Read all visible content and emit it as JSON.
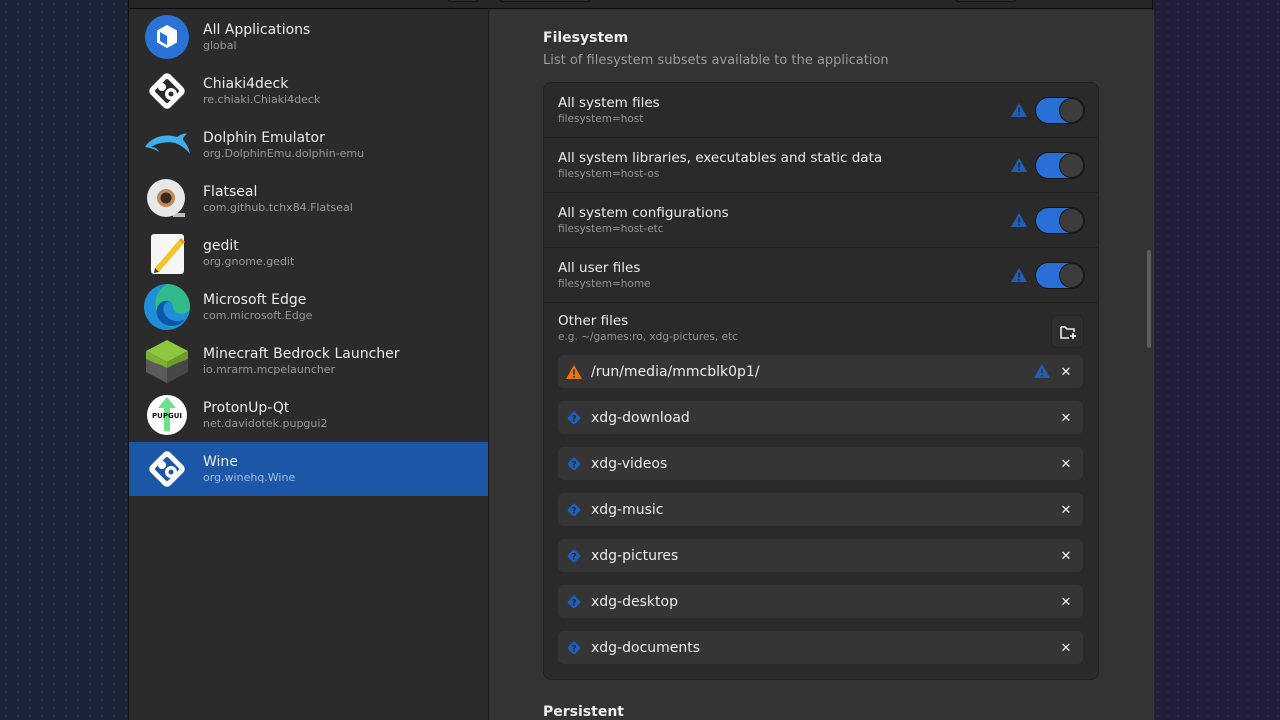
{
  "sidebar": {
    "apps": [
      {
        "name": "All Applications",
        "id": "global",
        "icon": "flatpak-box-icon",
        "selected": false
      },
      {
        "name": "Chiaki4deck",
        "id": "re.chiaki.Chiaki4deck",
        "icon": "chiaki-icon",
        "selected": false
      },
      {
        "name": "Dolphin Emulator",
        "id": "org.DolphinEmu.dolphin-emu",
        "icon": "dolphin-icon",
        "selected": false
      },
      {
        "name": "Flatseal",
        "id": "com.github.tchx84.Flatseal",
        "icon": "tape-roll-icon",
        "selected": false
      },
      {
        "name": "gedit",
        "id": "org.gnome.gedit",
        "icon": "notepad-pencil-icon",
        "selected": false
      },
      {
        "name": "Microsoft Edge",
        "id": "com.microsoft.Edge",
        "icon": "edge-icon",
        "selected": false
      },
      {
        "name": "Minecraft Bedrock Launcher",
        "id": "io.mrarm.mcpelauncher",
        "icon": "grass-block-icon",
        "selected": false
      },
      {
        "name": "ProtonUp-Qt",
        "id": "net.davidotek.pupgui2",
        "icon": "pupgui-icon",
        "selected": false,
        "badge_text": "PUPGUI"
      },
      {
        "name": "Wine",
        "id": "org.winehq.Wine",
        "icon": "wine-icon",
        "selected": true
      }
    ]
  },
  "filesystem": {
    "title": "Filesystem",
    "subtitle": "List of filesystem subsets available to the application",
    "toggles": [
      {
        "label": "All system files",
        "key": "filesystem=host",
        "enabled": true,
        "warning": true
      },
      {
        "label": "All system libraries, executables and static data",
        "key": "filesystem=host-os",
        "enabled": true,
        "warning": true
      },
      {
        "label": "All system configurations",
        "key": "filesystem=host-etc",
        "enabled": true,
        "warning": true
      },
      {
        "label": "All user files",
        "key": "filesystem=home",
        "enabled": true,
        "warning": true
      }
    ],
    "other_files": {
      "label": "Other files",
      "hint": "e.g. ~/games:ro, xdg-pictures, etc",
      "paths": [
        {
          "value": "/run/media/mmcblk0p1/",
          "status": "warning-orange",
          "override_warning": true
        },
        {
          "value": "xdg-download",
          "status": "unknown"
        },
        {
          "value": "xdg-videos",
          "status": "unknown"
        },
        {
          "value": "xdg-music",
          "status": "unknown"
        },
        {
          "value": "xdg-pictures",
          "status": "unknown"
        },
        {
          "value": "xdg-desktop",
          "status": "unknown"
        },
        {
          "value": "xdg-documents",
          "status": "unknown"
        }
      ],
      "remove_glyph": "✕"
    }
  },
  "persistent": {
    "title": "Persistent"
  },
  "colors": {
    "accent": "#2a6fd6",
    "selected_row": "#1c57a7",
    "warn_blue": "#1f5fb8",
    "warn_orange": "#e8740f"
  }
}
